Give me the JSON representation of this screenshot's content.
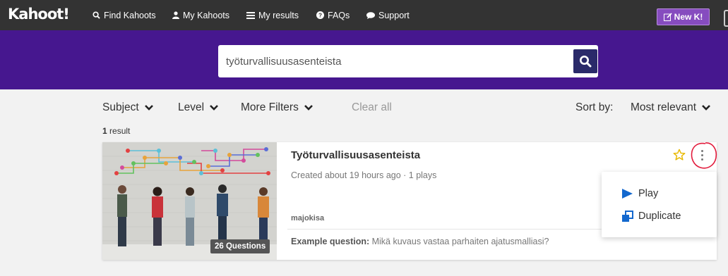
{
  "topbar": {
    "logo": "Kahoot!",
    "nav": [
      {
        "label": "Find Kahoots",
        "icon": "search-icon"
      },
      {
        "label": "My Kahoots",
        "icon": "user-icon"
      },
      {
        "label": "My results",
        "icon": "list-icon"
      },
      {
        "label": "FAQs",
        "icon": "question-icon"
      },
      {
        "label": "Support",
        "icon": "speech-bubble-icon"
      }
    ],
    "new_button": "New K!"
  },
  "search": {
    "value": "työturvallisuusasenteista"
  },
  "filters": {
    "subject": "Subject",
    "level": "Level",
    "more": "More Filters",
    "clear": "Clear all",
    "sort_label": "Sort by:",
    "sort_value": "Most relevant"
  },
  "results": {
    "count": "1",
    "count_label": " result"
  },
  "card": {
    "title": "Työturvallisuusasenteista",
    "meta": "Created about 19 hours ago · 1 plays",
    "author": "majokisa",
    "questions": "26 Questions",
    "example_label": "Example question:",
    "example_text": " Mikä kuvaus vastaa parhaiten ajatusmalliasi?"
  },
  "menu": {
    "play": "Play",
    "duplicate": "Duplicate"
  },
  "colors": {
    "topbar": "#333333",
    "band": "#46178f",
    "accent": "#864cbf",
    "menu_icon": "#1368ce",
    "annotation": "#e21b3c"
  }
}
